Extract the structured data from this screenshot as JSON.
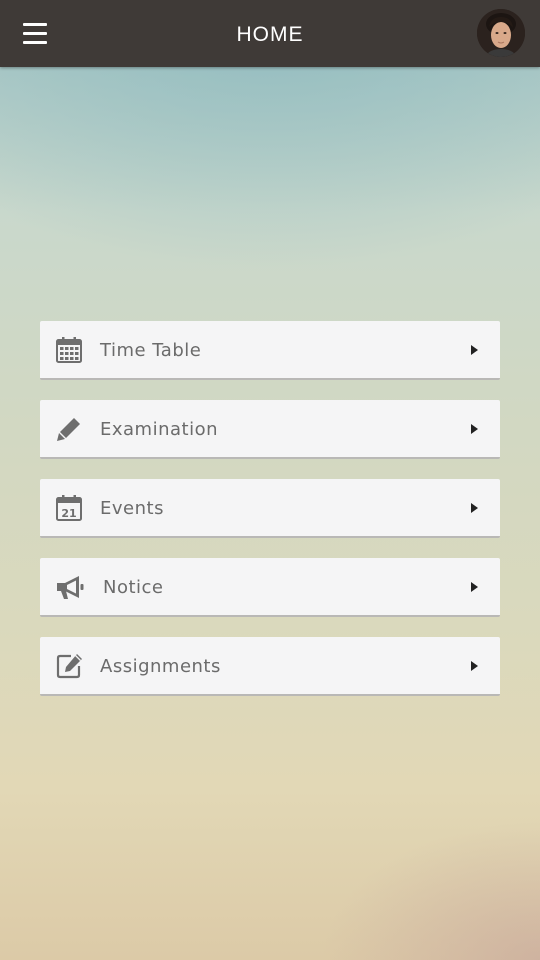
{
  "header": {
    "title": "HOME",
    "menu_icon": "hamburger-menu-icon",
    "avatar_icon": "user-avatar"
  },
  "menu": {
    "items": [
      {
        "label": "Time Table",
        "icon": "calendar-grid-icon"
      },
      {
        "label": "Examination",
        "icon": "pencil-icon"
      },
      {
        "label": "Events",
        "icon": "calendar-21-icon",
        "icon_text": "21"
      },
      {
        "label": "Notice",
        "icon": "megaphone-icon"
      },
      {
        "label": "Assignments",
        "icon": "edit-square-icon"
      }
    ]
  },
  "colors": {
    "header_bg": "#3f3a37",
    "card_bg": "#f5f5f6",
    "label_text": "#6b6b6b",
    "icon": "#6e6e6e"
  }
}
